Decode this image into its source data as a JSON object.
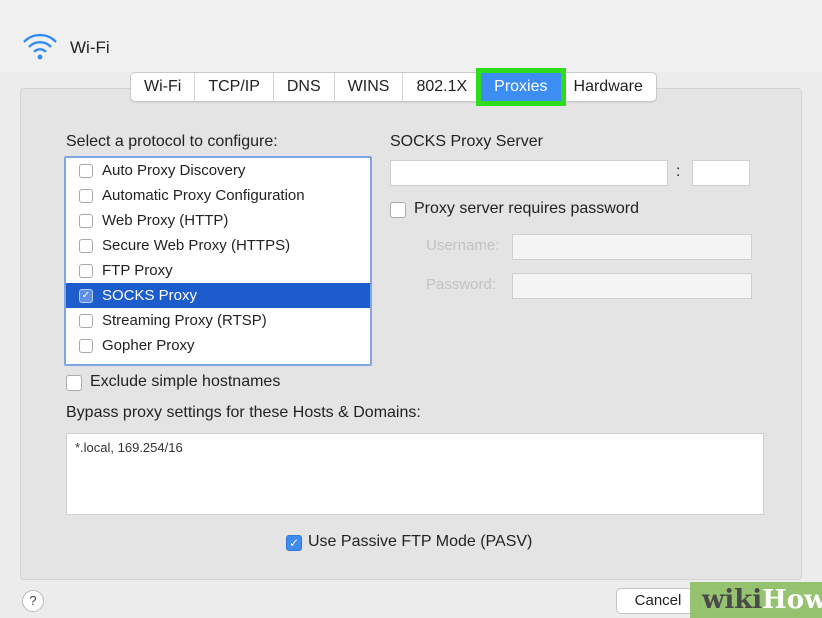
{
  "window": {
    "title": "Wi-Fi"
  },
  "tabs": [
    {
      "label": "Wi-Fi"
    },
    {
      "label": "TCP/IP"
    },
    {
      "label": "DNS"
    },
    {
      "label": "WINS"
    },
    {
      "label": "802.1X"
    },
    {
      "label": "Proxies",
      "active": true
    },
    {
      "label": "Hardware"
    }
  ],
  "protocols": {
    "heading": "Select a protocol to configure:",
    "items": [
      {
        "label": "Auto Proxy Discovery",
        "checked": false
      },
      {
        "label": "Automatic Proxy Configuration",
        "checked": false
      },
      {
        "label": "Web Proxy (HTTP)",
        "checked": false
      },
      {
        "label": "Secure Web Proxy (HTTPS)",
        "checked": false
      },
      {
        "label": "FTP Proxy",
        "checked": false
      },
      {
        "label": "SOCKS Proxy",
        "checked": true,
        "selected": true
      },
      {
        "label": "Streaming Proxy (RTSP)",
        "checked": false
      },
      {
        "label": "Gopher Proxy",
        "checked": false
      }
    ]
  },
  "server": {
    "heading": "SOCKS Proxy Server",
    "colon": ":",
    "requires_password": "Proxy server requires password",
    "username_label": "Username:",
    "password_label": "Password:"
  },
  "exclude": {
    "label": "Exclude simple hostnames"
  },
  "bypass": {
    "label": "Bypass proxy settings for these Hosts & Domains:",
    "value": "*.local, 169.254/16"
  },
  "pasv": {
    "label": "Use Passive FTP Mode (PASV)",
    "checked": true
  },
  "footer": {
    "help": "?",
    "cancel": "Cancel",
    "watermark_a": "wiki",
    "watermark_b": "How"
  },
  "colors": {
    "accent": "#3c8ef4",
    "selection": "#1d5ccc",
    "highlight": "#2fdc1b"
  }
}
